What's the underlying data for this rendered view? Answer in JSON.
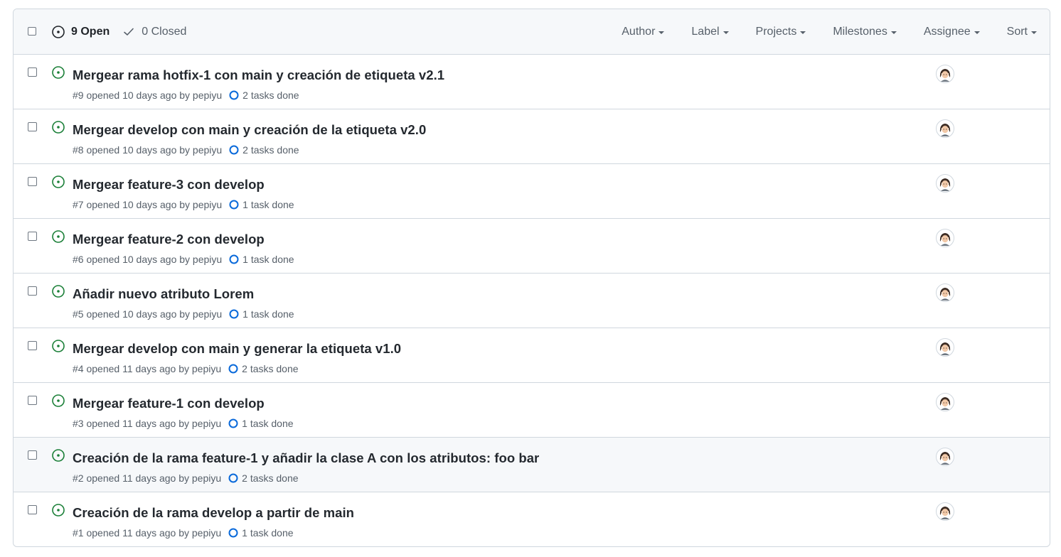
{
  "header": {
    "open_label": "9 Open",
    "closed_label": "0 Closed",
    "filters": [
      "Author",
      "Label",
      "Projects",
      "Milestones",
      "Assignee",
      "Sort"
    ]
  },
  "issues": [
    {
      "title": "Mergear rama hotfix-1 con main y creación de etiqueta v2.1",
      "meta": "#9 opened 10 days ago by pepiyu",
      "tasks": "2 tasks done"
    },
    {
      "title": "Mergear develop con main y creación de la etiqueta v2.0",
      "meta": "#8 opened 10 days ago by pepiyu",
      "tasks": "2 tasks done"
    },
    {
      "title": "Mergear feature-3 con develop",
      "meta": "#7 opened 10 days ago by pepiyu",
      "tasks": "1 task done"
    },
    {
      "title": "Mergear feature-2 con develop",
      "meta": "#6 opened 10 days ago by pepiyu",
      "tasks": "1 task done"
    },
    {
      "title": "Añadir nuevo atributo Lorem",
      "meta": "#5 opened 10 days ago by pepiyu",
      "tasks": "1 task done"
    },
    {
      "title": "Mergear develop con main y generar la etiqueta v1.0",
      "meta": "#4 opened 11 days ago by pepiyu",
      "tasks": "2 tasks done"
    },
    {
      "title": "Mergear feature-1 con develop",
      "meta": "#3 opened 11 days ago by pepiyu",
      "tasks": "1 task done"
    },
    {
      "title": "Creación de la rama feature-1 y añadir la clase A con los atributos: foo bar",
      "meta": "#2 opened 11 days ago by pepiyu",
      "tasks": "2 tasks done"
    },
    {
      "title": "Creación de la rama develop a partir de main",
      "meta": "#1 opened 11 days ago by pepiyu",
      "tasks": "1 task done"
    }
  ],
  "colors": {
    "open_icon": "#1a7f37",
    "task_icon": "#0969da",
    "border": "#d0d7de",
    "header_bg": "#f6f8fa"
  },
  "icons": {
    "open_state": "issue-opened-icon",
    "closed_state": "check-icon",
    "issue": "issue-opened-icon",
    "tasks": "task-progress-icon",
    "assignee": "avatar"
  }
}
